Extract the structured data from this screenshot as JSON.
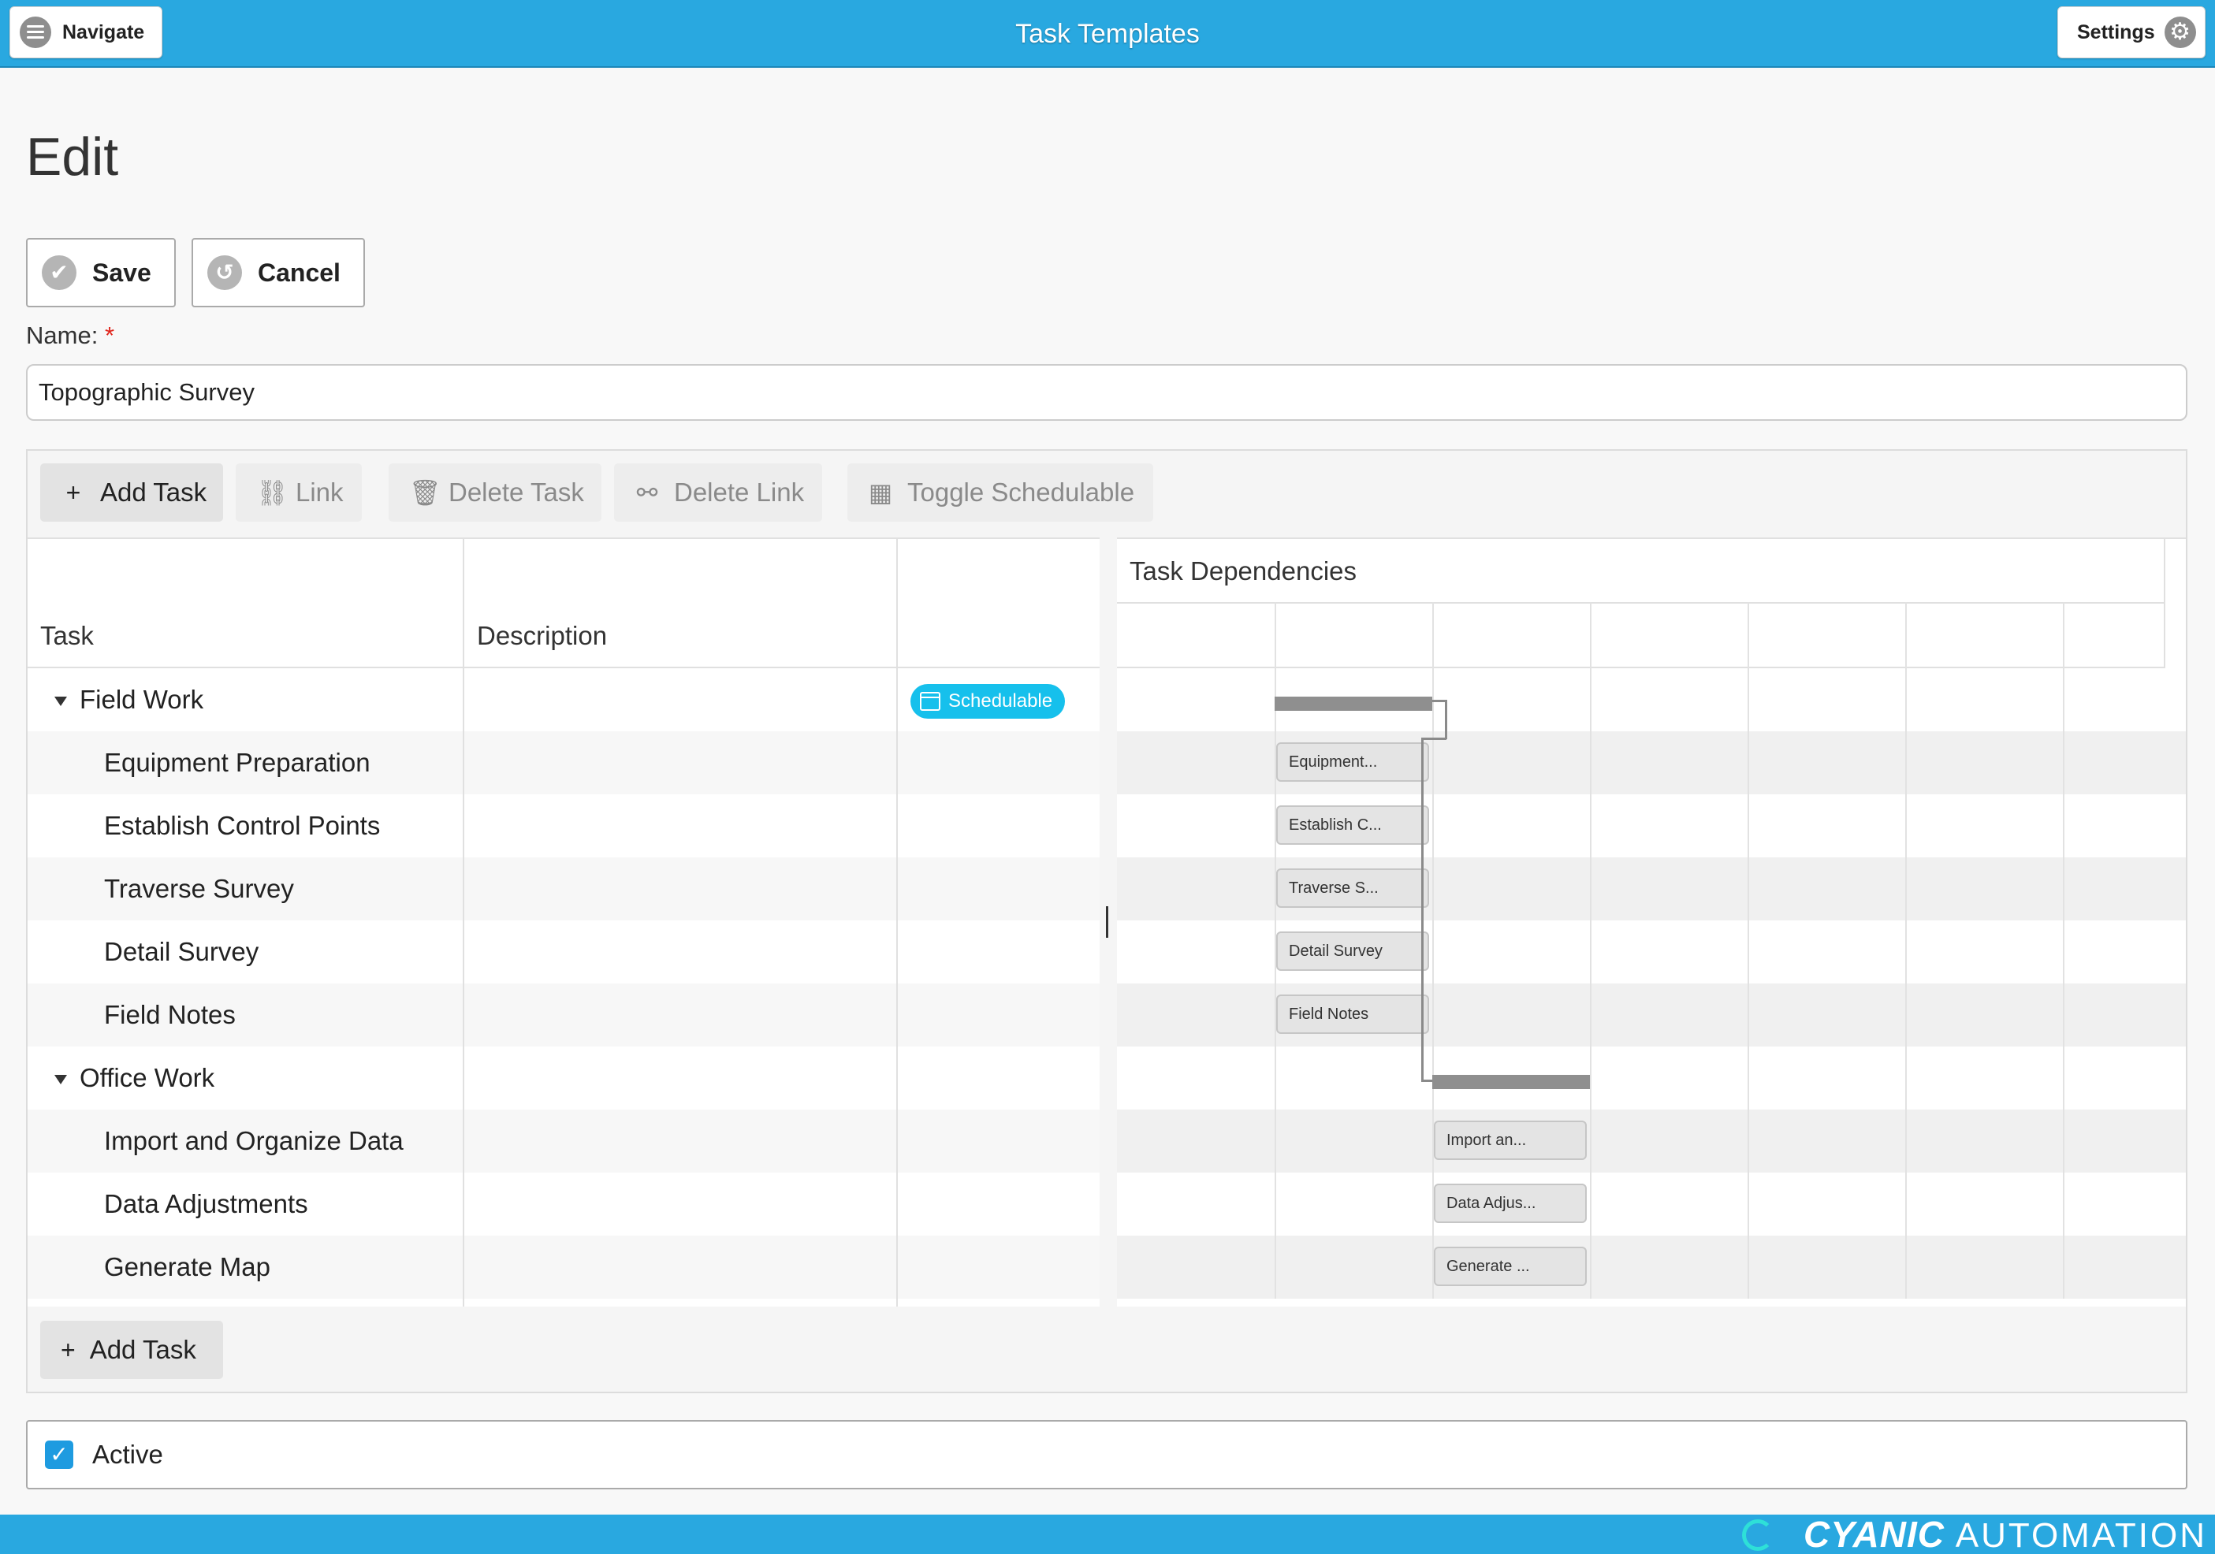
{
  "header": {
    "title": "Task Templates",
    "navigate_label": "Navigate",
    "settings_label": "Settings"
  },
  "page": {
    "title": "Edit",
    "save_label": "Save",
    "cancel_label": "Cancel",
    "name_label": "Name:",
    "name_required_mark": "*",
    "name_value": "Topographic Survey"
  },
  "toolbar": {
    "add_task": "Add Task",
    "link": "Link",
    "delete_task": "Delete Task",
    "delete_link": "Delete Link",
    "toggle_schedulable": "Toggle Schedulable"
  },
  "grid": {
    "col_task": "Task",
    "col_description": "Description",
    "badge_label": "Schedulable",
    "rows": [
      {
        "name": "Field Work",
        "group": true,
        "bar": "",
        "schedulable": true
      },
      {
        "name": "Equipment Preparation",
        "group": false,
        "bar": "Equipment..."
      },
      {
        "name": "Establish Control Points",
        "group": false,
        "bar": "Establish C..."
      },
      {
        "name": "Traverse Survey",
        "group": false,
        "bar": "Traverse S..."
      },
      {
        "name": "Detail Survey",
        "group": false,
        "bar": "Detail Survey"
      },
      {
        "name": "Field Notes",
        "group": false,
        "bar": "Field Notes"
      },
      {
        "name": "Office Work",
        "group": true,
        "bar": ""
      },
      {
        "name": "Import and Organize Data",
        "group": false,
        "bar": "Import an..."
      },
      {
        "name": "Data Adjustments",
        "group": false,
        "bar": "Data Adjus..."
      },
      {
        "name": "Generate Map",
        "group": false,
        "bar": "Generate ..."
      }
    ]
  },
  "chart": {
    "title": "Task Dependencies"
  },
  "bottom": {
    "add_task": "Add Task",
    "active_label": "Active",
    "active_checked": true
  },
  "footer": {
    "brand_a": "CYANIC",
    "brand_b": "AUTOMATION"
  },
  "colors": {
    "header": "#29a8e0",
    "badge": "#16c0ec",
    "checkbox": "#1e9be0"
  }
}
